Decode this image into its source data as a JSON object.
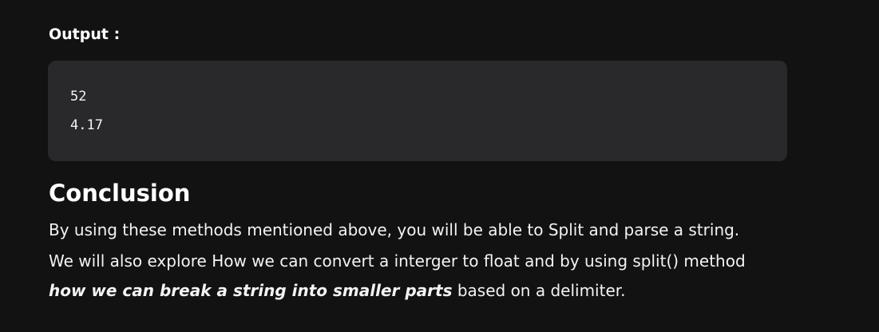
{
  "output": {
    "label": "Output :"
  },
  "code": {
    "lines": [
      "52",
      "4.17"
    ]
  },
  "conclusion": {
    "heading": "Conclusion",
    "line1": "By using these methods mentioned above, you will be able to Split and parse a string.",
    "line2": "We will also explore How we can convert a interger to float and by using split() method",
    "line3_emphasis": "how we can break a string into smaller parts",
    "line3_rest": " based on a delimiter."
  }
}
